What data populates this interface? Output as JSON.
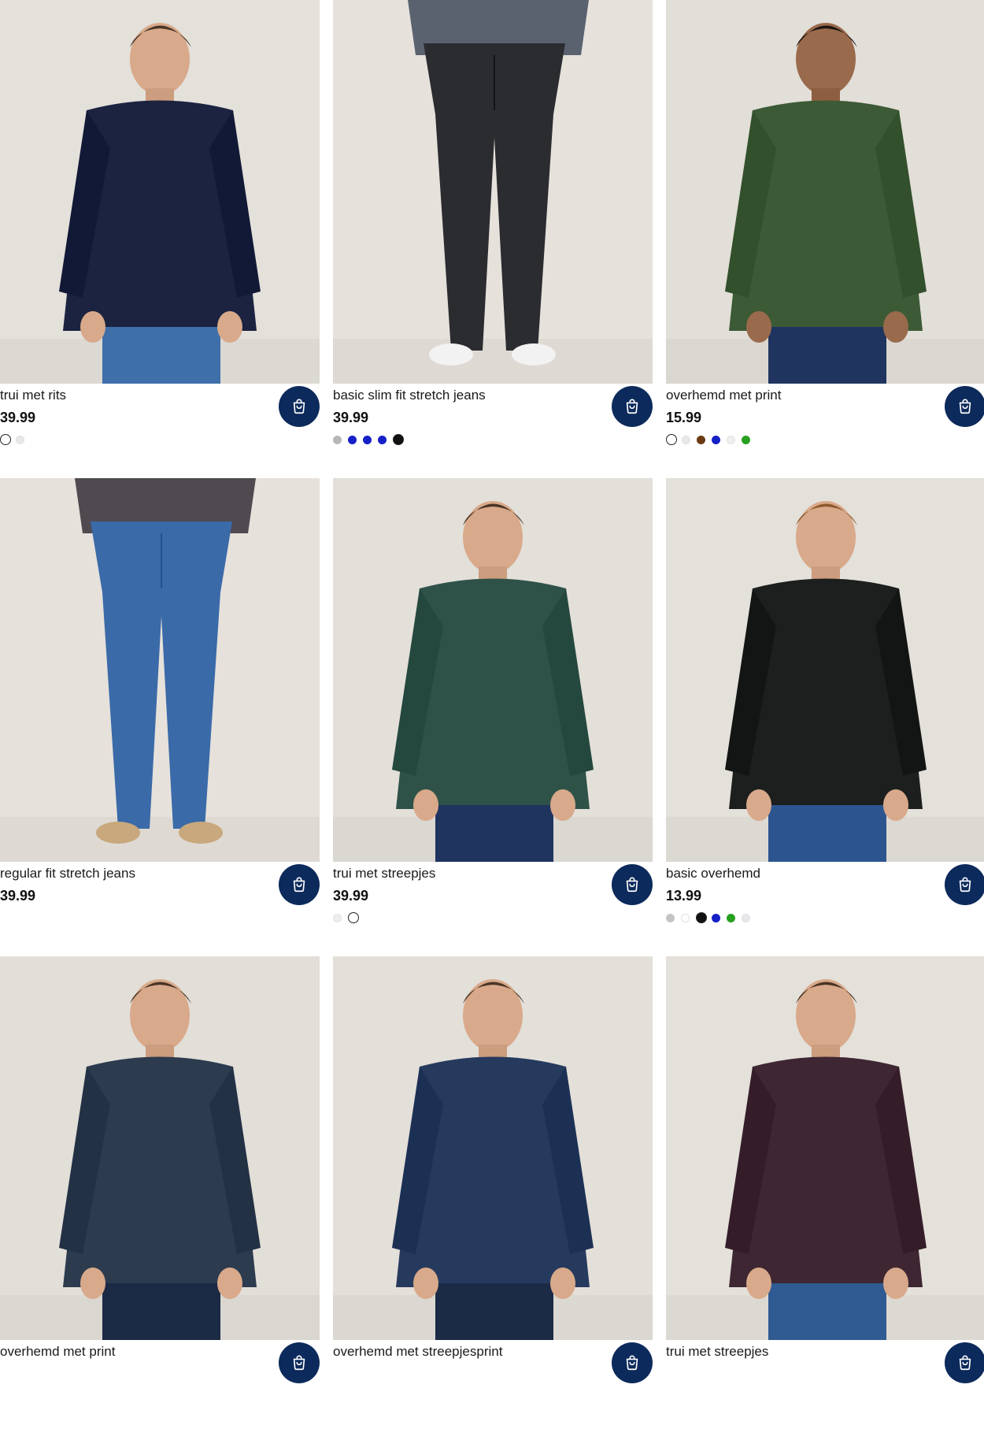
{
  "products": [
    {
      "title": "trui met rits",
      "price": "39.99",
      "swatches": [
        {
          "color": "#ffffff",
          "selected": true
        },
        {
          "color": "#e8e8ec",
          "selected": false
        }
      ],
      "photo": {
        "bg": "#e4e0da",
        "top_color": "#1b2340",
        "bottom_color": "#3e6fa8",
        "skin": "#d8a98a",
        "hair": "#4a3526"
      }
    },
    {
      "title": "basic slim fit stretch jeans",
      "price": "39.99",
      "swatches": [
        {
          "color": "#b8b8b8",
          "selected": false
        },
        {
          "color": "#1520c8",
          "selected": false
        },
        {
          "color": "#1520c8",
          "selected": false
        },
        {
          "color": "#1520c8",
          "selected": false
        },
        {
          "color": "#111111",
          "selected": true
        }
      ],
      "photo": {
        "bg": "#e6e1db",
        "top_color": "#5a6270",
        "bottom_color": "#2b2c30",
        "skin": "#d8a98a",
        "hair": "#4a3526"
      }
    },
    {
      "title": "overhemd met print",
      "price": "15.99",
      "swatches": [
        {
          "color": "#ffffff",
          "selected": true
        },
        {
          "color": "#e8e8ec",
          "selected": false
        },
        {
          "color": "#6b3a12",
          "selected": false
        },
        {
          "color": "#1520c8",
          "selected": false
        },
        {
          "color": "#eeeeee",
          "selected": false
        },
        {
          "color": "#28a020",
          "selected": false
        }
      ],
      "photo": {
        "bg": "#e2ded8",
        "top_color": "#3c5a35",
        "bottom_color": "#1f3560",
        "skin": "#9a6a4c",
        "hair": "#1c1612"
      }
    },
    {
      "title": "regular fit stretch jeans",
      "price": "39.99",
      "swatches": [],
      "photo": {
        "bg": "#e6e1db",
        "top_color": "#4f4a50",
        "bottom_color": "#3a6aa8",
        "skin": "#d8a98a",
        "hair": "#4a3526"
      }
    },
    {
      "title": "trui met streepjes",
      "price": "39.99",
      "swatches": [
        {
          "color": "#ededed",
          "selected": false
        },
        {
          "color": "#ffffff",
          "selected": true
        }
      ],
      "photo": {
        "bg": "#e3dfd9",
        "top_color": "#2f5248",
        "bottom_color": "#1f3560",
        "skin": "#d8a98a",
        "hair": "#4a3526"
      }
    },
    {
      "title": "basic overhemd",
      "price": "13.99",
      "swatches": [
        {
          "color": "#c4c4c4",
          "selected": false
        },
        {
          "color": "#ffffff",
          "selected": false
        },
        {
          "color": "#111111",
          "selected": true
        },
        {
          "color": "#1520c8",
          "selected": false
        },
        {
          "color": "#28a020",
          "selected": false
        },
        {
          "color": "#e8e8ec",
          "selected": false
        }
      ],
      "photo": {
        "bg": "#e4e0da",
        "top_color": "#1c1f1e",
        "bottom_color": "#2c5590",
        "skin": "#d8a98a",
        "hair": "#8c5a2c"
      }
    },
    {
      "title": "overhemd met print",
      "price": "",
      "swatches": [],
      "photo": {
        "bg": "#e2ded8",
        "top_color": "#2c3b4e",
        "bottom_color": "#1b2a45",
        "skin": "#d8a98a",
        "hair": "#4a3526"
      }
    },
    {
      "title": "overhemd met streepjesprint",
      "price": "",
      "swatches": [],
      "photo": {
        "bg": "#e3dfd9",
        "top_color": "#263a5e",
        "bottom_color": "#1b2a45",
        "skin": "#d8a98a",
        "hair": "#4a3526"
      }
    },
    {
      "title": "trui met streepjes",
      "price": "",
      "swatches": [],
      "photo": {
        "bg": "#e4e0da",
        "top_color": "#3e2632",
        "bottom_color": "#2f5a92",
        "skin": "#d8a98a",
        "hair": "#4a3526"
      }
    }
  ],
  "cart_button": {
    "icon": "shopping-bag-icon",
    "bg": "#0c2a5b",
    "icon_color": "#ffffff"
  }
}
